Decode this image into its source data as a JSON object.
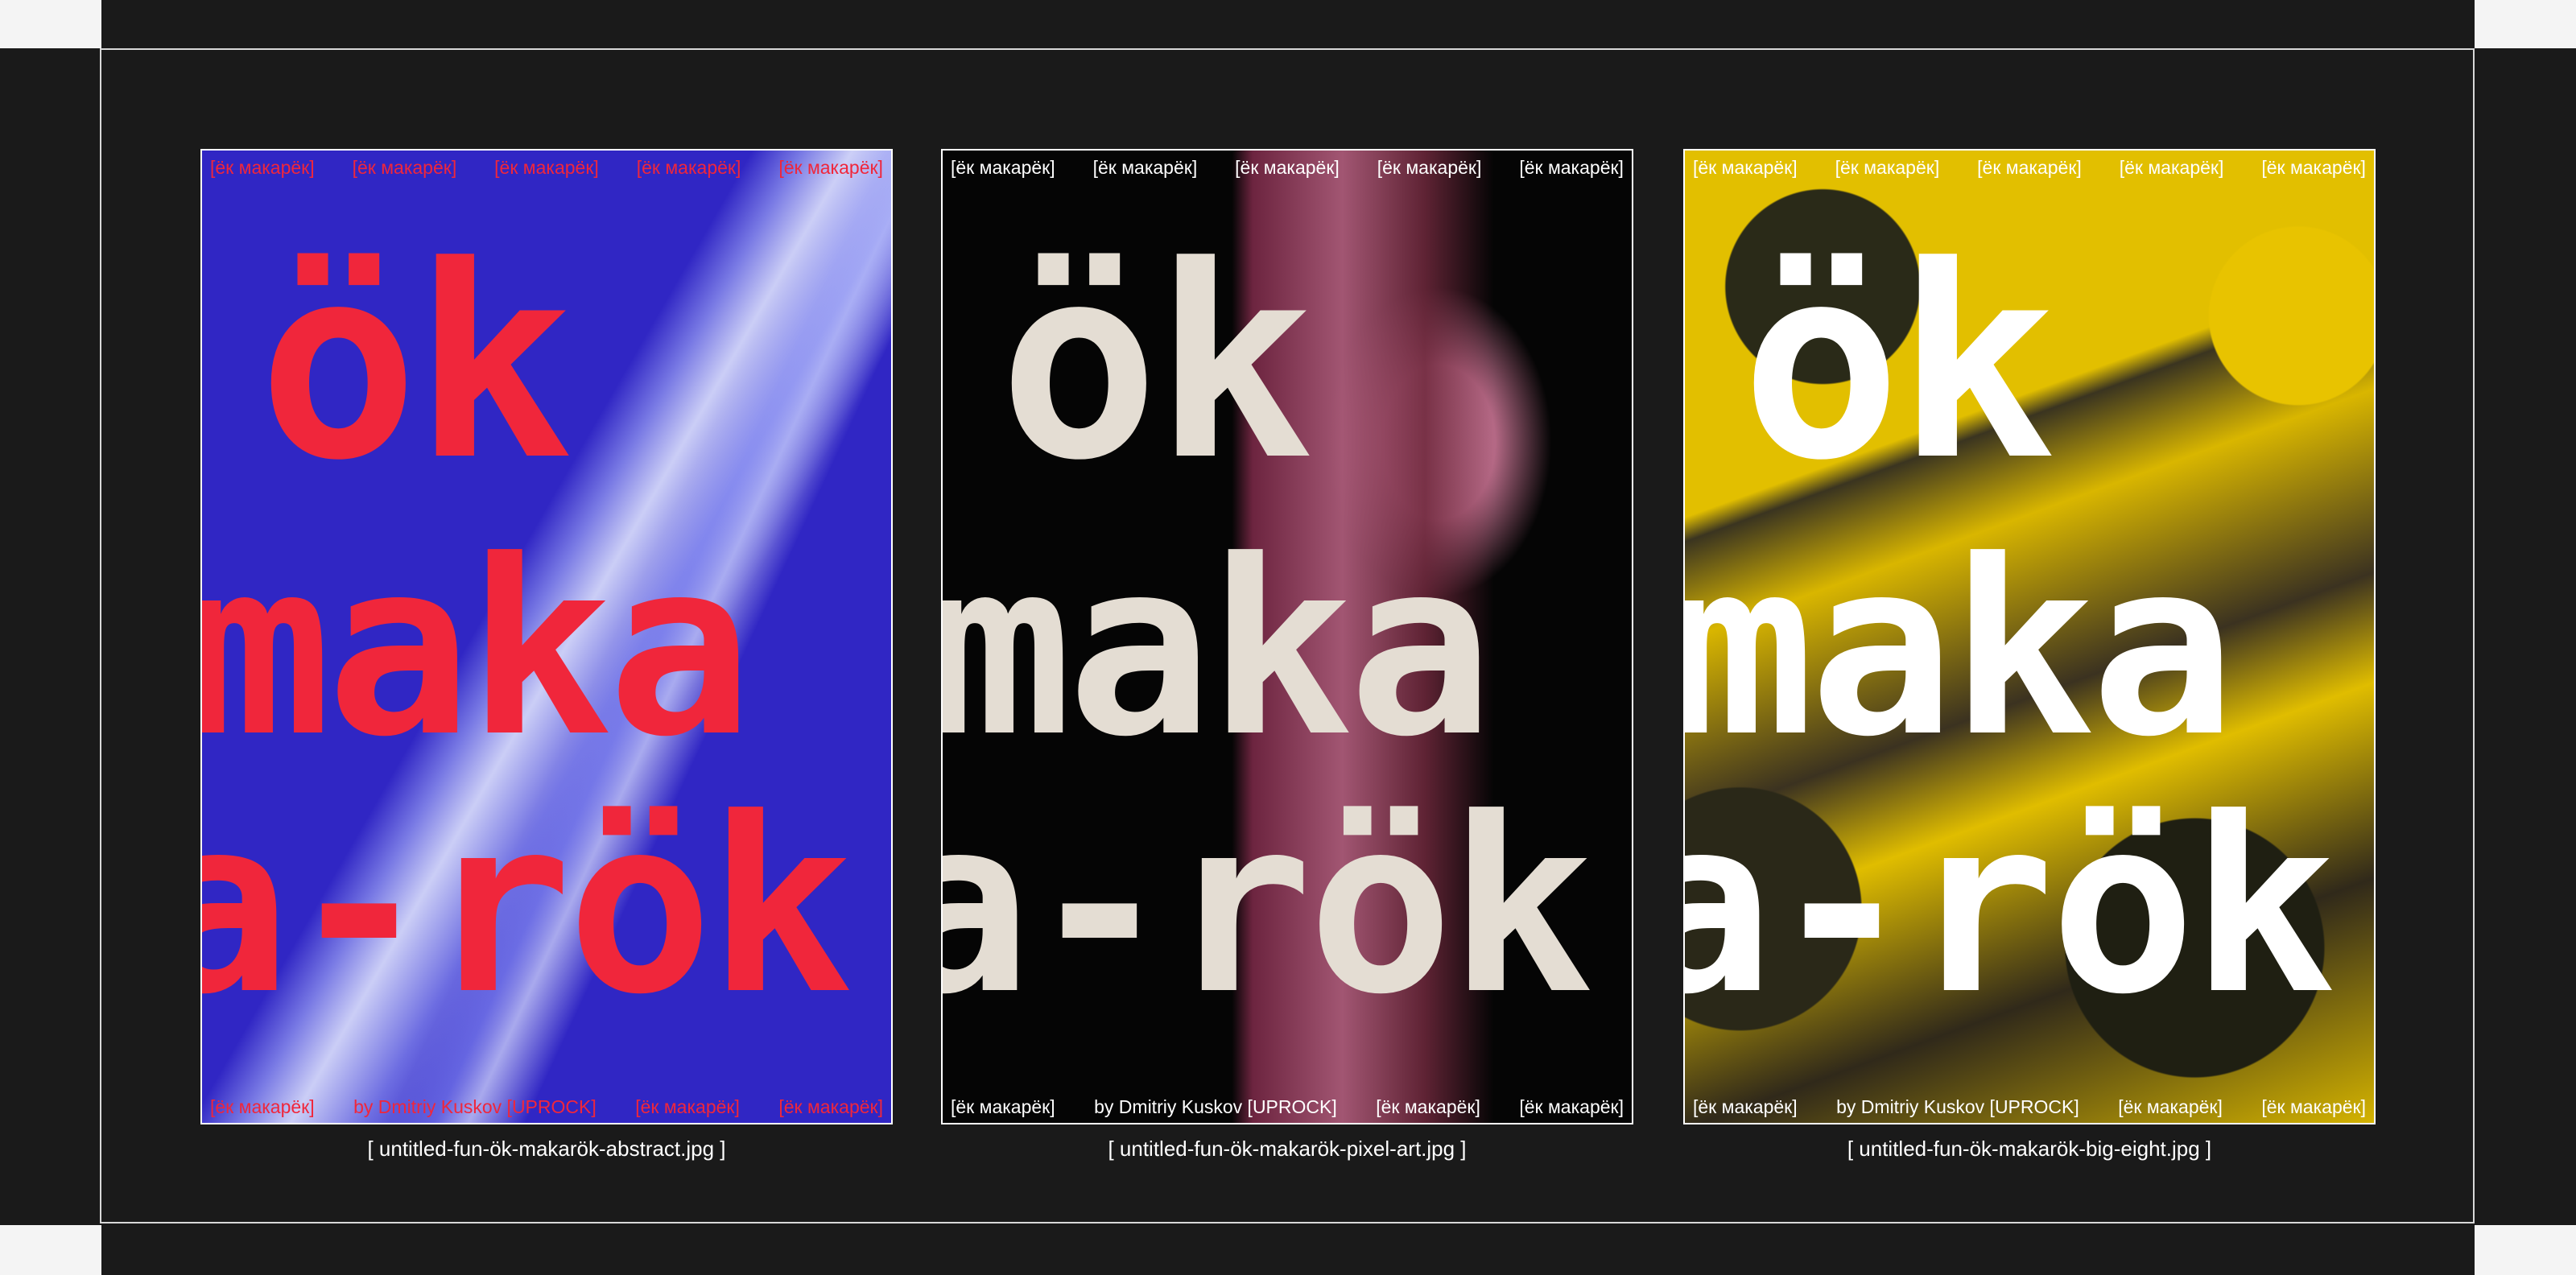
{
  "posters": [
    {
      "big_lines": [
        "ök",
        "maka",
        "a-rök"
      ],
      "top_strip": [
        "[ёк макарёк]",
        "[ёк макарёк]",
        "[ёк макарёк]",
        "[ёк макарёк]",
        "[ёк макарёк]"
      ],
      "bottom_strip": [
        "[ёк макарёк]",
        "by Dmitriy Kuskov [UPROCK]",
        "[ёк макарёк]",
        "[ёк макарёк]"
      ],
      "caption": "[ untitled-fun-ök-makarök-abstract.jpg ]",
      "accent": "#f0263b",
      "background": "#2f24c8"
    },
    {
      "big_lines": [
        "ök",
        "maka",
        "a-rök"
      ],
      "top_strip": [
        "[ёк макарёк]",
        "[ёк макарёк]",
        "[ёк макарёк]",
        "[ёк макарёк]",
        "[ёк макарёк]"
      ],
      "bottom_strip": [
        "[ёк макарёк]",
        "by Dmitriy Kuskov [UPROCK]",
        "[ёк макарёк]",
        "[ёк макарёк]"
      ],
      "caption": "[ untitled-fun-ök-makarök-pixel-art.jpg ]",
      "accent": "#e4ddd3",
      "background": "#050505"
    },
    {
      "big_lines": [
        "ök",
        "maka",
        "a-rök"
      ],
      "top_strip": [
        "[ёк макарёк]",
        "[ёк макарёк]",
        "[ёк макарёк]",
        "[ёк макарёк]",
        "[ёк макарёк]"
      ],
      "bottom_strip": [
        "[ёк макарёк]",
        "by Dmitriy Kuskov [UPROCK]",
        "[ёк макарёк]",
        "[ёк макарёк]"
      ],
      "caption": "[ untitled-fun-ök-makarök-big-eight.jpg ]",
      "accent": "#ffffff",
      "background": "#d9b800"
    }
  ]
}
